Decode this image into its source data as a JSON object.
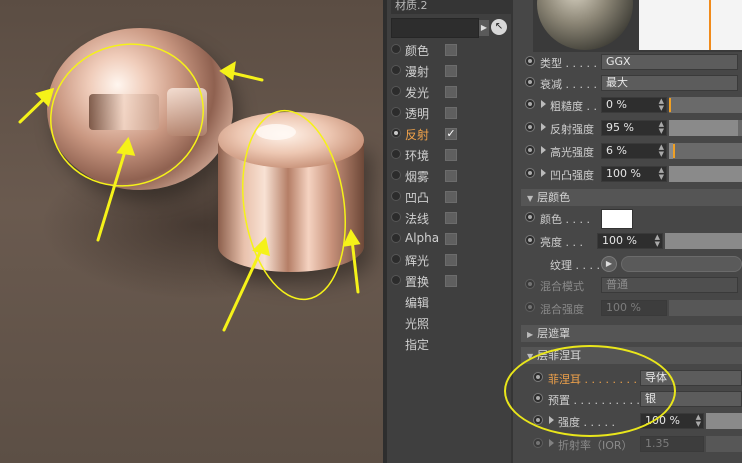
{
  "material": {
    "title": "材质.2"
  },
  "channels": [
    {
      "label": "颜色",
      "checked": false,
      "active": false,
      "radio_on": false
    },
    {
      "label": "漫射",
      "checked": false,
      "active": false,
      "radio_on": false
    },
    {
      "label": "发光",
      "checked": false,
      "active": false,
      "radio_on": false
    },
    {
      "label": "透明",
      "checked": false,
      "active": false,
      "radio_on": false
    },
    {
      "label": "反射",
      "checked": true,
      "active": true,
      "radio_on": true
    },
    {
      "label": "环境",
      "checked": false,
      "active": false,
      "radio_on": false
    },
    {
      "label": "烟雾",
      "checked": false,
      "active": false,
      "radio_on": false
    },
    {
      "label": "凹凸",
      "checked": false,
      "active": false,
      "radio_on": false
    },
    {
      "label": "法线",
      "checked": false,
      "active": false,
      "radio_on": false
    },
    {
      "label": "Alpha",
      "checked": false,
      "active": false,
      "radio_on": false
    },
    {
      "label": "辉光",
      "checked": false,
      "active": false,
      "radio_on": false
    },
    {
      "label": "置换",
      "checked": false,
      "active": false,
      "radio_on": false
    }
  ],
  "channel_links": [
    "编辑",
    "光照",
    "指定"
  ],
  "reflection": {
    "type_label": "类型 . . . . . .",
    "type_value": "GGX",
    "attenuation_label": "衰减 . . . . . .",
    "attenuation_value": "最大",
    "roughness_label": "粗糙度 . .",
    "roughness_value": "0 %",
    "roughness_level": 0,
    "reflect_strength_label": "反射强度",
    "reflect_strength_value": "95 %",
    "reflect_strength_level": 0.95,
    "specular_strength_label": "高光强度",
    "specular_strength_value": "6 %",
    "specular_strength_level": 0.06,
    "bump_strength_label": "凹凸强度",
    "bump_strength_value": "100 %",
    "bump_strength_level": 1.0
  },
  "layer_color": {
    "header": "层颜色",
    "color_label": "颜色 . . . .",
    "color_value": "#ffffff",
    "brightness_label": "亮度 . . .",
    "brightness_value": "100 %",
    "texture_label": "纹理 . . . .",
    "blend_mode_label": "混合模式",
    "blend_mode_value": "普通",
    "blend_strength_label": "混合强度",
    "blend_strength_value": "100 %"
  },
  "layer_mask": {
    "header": "层遮罩"
  },
  "layer_fresnel": {
    "header": "层菲涅耳",
    "fresnel_label": "菲涅耳 . . . . . . . . . .",
    "fresnel_value": "导体",
    "preset_label": "预置 . . . . . . . . . . .",
    "preset_value": "银",
    "strength_label": "强度 . . . . .",
    "strength_value": "100 %",
    "ior_label": "折射率（IOR）",
    "ior_value": "1.35"
  },
  "colors": {
    "accent_orange": "#f0a24a",
    "annotation_yellow": "#f5f219"
  }
}
